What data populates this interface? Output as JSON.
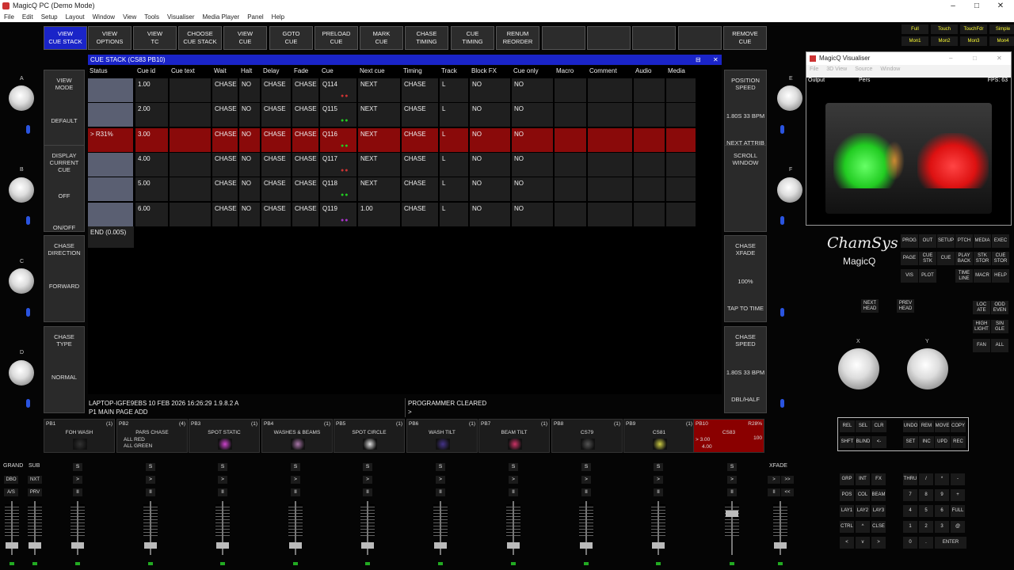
{
  "titlebar": {
    "title": "MagicQ PC (Demo Mode)",
    "minimize": "–",
    "maximize": "□",
    "close": "✕"
  },
  "menubar": [
    "File",
    "Edit",
    "Setup",
    "Layout",
    "Window",
    "View",
    "Tools",
    "Visualiser",
    "Media Player",
    "Panel",
    "Help"
  ],
  "topbar": [
    "VIEW\nCUE STACK",
    "VIEW\nOPTIONS",
    "VIEW\nTC",
    "CHOOSE\nCUE STACK",
    "VIEW\nCUE",
    "GOTO\nCUE",
    "PRELOAD\nCUE",
    "MARK\nCUE",
    "CHASE\nTIMING",
    "CUE\nTIMING",
    "RENUM\nREORDER",
    "",
    "",
    "",
    "",
    "REMOVE\nCUE"
  ],
  "left_panels": [
    {
      "a": "VIEW\nMODE",
      "b": "DEFAULT",
      "c": ""
    },
    {
      "a": "DISPLAY\nCURRENT CUE",
      "b": "OFF",
      "c": "ON/OFF"
    },
    {
      "a": "CHASE\nDIRECTION",
      "b": "FORWARD",
      "c": ""
    },
    {
      "a": "CHASE\nTYPE",
      "b": "NORMAL",
      "c": ""
    }
  ],
  "knob_labels": {
    "a": "A",
    "b": "B",
    "c": "C",
    "d": "D",
    "e": "E",
    "f": "F",
    "x": "X",
    "y": "Y"
  },
  "right_panels": [
    {
      "a": "POSITION\nSPEED",
      "b": "1.80S  33 BPM",
      "c": "NEXT ATTRIB"
    },
    {
      "a": "SCROLL\nWINDOW",
      "b": "",
      "c": ""
    },
    {
      "a": "CHASE\nXFADE",
      "b": "100%",
      "c": "TAP TO TIME"
    },
    {
      "a": "CHASE\nSPEED",
      "b": "1.80S  33 BPM",
      "c": "DBL/HALF"
    }
  ],
  "window": {
    "title": "CUE STACK (CS83 PB10)",
    "pin": "⊟",
    "close": "✕"
  },
  "columns": [
    "Status",
    "Cue id",
    "Cue text",
    "Wait",
    "Halt",
    "Delay",
    "Fade",
    "Cue",
    "Next cue",
    "Timing",
    "Track",
    "Block FX",
    "Cue only",
    "Macro",
    "Comment",
    "Audio",
    "Media"
  ],
  "rows": [
    {
      "status": "",
      "id": "1.00",
      "text": "",
      "wait": "CHASE",
      "halt": "NO",
      "delay": "CHASE",
      "fade": "CHASE",
      "cue": "Q114",
      "next": "NEXT",
      "timing": "CHASE",
      "track": "L",
      "block": "NO",
      "only": "NO",
      "dots": "#c33"
    },
    {
      "status": "",
      "id": "2.00",
      "text": "",
      "wait": "CHASE",
      "halt": "NO",
      "delay": "CHASE",
      "fade": "CHASE",
      "cue": "Q115",
      "next": "NEXT",
      "timing": "CHASE",
      "track": "L",
      "block": "NO",
      "only": "NO",
      "dots": "#2c2"
    },
    {
      "status": "> R31%",
      "id": "3.00",
      "text": "",
      "wait": "CHASE",
      "halt": "NO",
      "delay": "CHASE",
      "fade": "CHASE",
      "cue": "Q116",
      "next": "NEXT",
      "timing": "CHASE",
      "track": "L",
      "block": "NO",
      "only": "NO",
      "dots": "#2c2"
    },
    {
      "status": "",
      "id": "4.00",
      "text": "",
      "wait": "CHASE",
      "halt": "NO",
      "delay": "CHASE",
      "fade": "CHASE",
      "cue": "Q117",
      "next": "NEXT",
      "timing": "CHASE",
      "track": "L",
      "block": "NO",
      "only": "NO",
      "dots": "#c33"
    },
    {
      "status": "",
      "id": "5.00",
      "text": "",
      "wait": "CHASE",
      "halt": "NO",
      "delay": "CHASE",
      "fade": "CHASE",
      "cue": "Q118",
      "next": "NEXT",
      "timing": "CHASE",
      "track": "L",
      "block": "NO",
      "only": "NO",
      "dots": "#2c2"
    },
    {
      "status": "",
      "id": "6.00",
      "text": "",
      "wait": "CHASE",
      "halt": "NO",
      "delay": "CHASE",
      "fade": "CHASE",
      "cue": "Q119",
      "next": "1.00",
      "timing": "CHASE",
      "track": "L",
      "block": "NO",
      "only": "NO",
      "dots": "#a3c"
    }
  ],
  "end_row": "END (0.00S)",
  "statusbar": {
    "line1": "LAPTOP-IGFE9EBS 10 FEB 2026 16:26:29 1.9.8.2  A",
    "line2": "P1 MAIN PAGE   ADD",
    "prog": "PROGRAMMER CLEARED",
    "prompt": ">"
  },
  "playbacks": [
    {
      "id": "PB1",
      "count": "(1)",
      "name": "FOH WASH",
      "color": "#333"
    },
    {
      "id": "PB2",
      "count": "(4)",
      "name": "PARS CHASE",
      "sub": "ALL RED\nALL GREEN",
      "color": "#333"
    },
    {
      "id": "PB3",
      "count": "(1)",
      "name": "SPOT STATIC",
      "color": "#c4c"
    },
    {
      "id": "PB4",
      "count": "(1)",
      "name": "WASHES & BEAMS",
      "color": "#a7a"
    },
    {
      "id": "PB5",
      "count": "(1)",
      "name": "SPOT CIRCLE",
      "color": "#ddd"
    },
    {
      "id": "PB6",
      "count": "(1)",
      "name": "WASH TILT",
      "color": "#438"
    },
    {
      "id": "PB7",
      "count": "(1)",
      "name": "BEAM TILT",
      "color": "#c36"
    },
    {
      "id": "PB8",
      "count": "(1)",
      "name": "CS79",
      "color": "#555"
    },
    {
      "id": "PB9",
      "count": "(1)",
      "name": "CS81",
      "color": "#cc4"
    },
    {
      "id": "PB10",
      "count": "R28%",
      "name": "CS83",
      "cur": "> 3.00",
      "next": "4.00",
      "level": "100",
      "color": "#c00"
    }
  ],
  "grand": {
    "grand": "GRAND",
    "sub": "SUB",
    "xfade": "XFADE",
    "dbo": "DBO",
    "nxt": "NXT",
    "as": "A/S",
    "prv": "PRV",
    "s": "S",
    ">": ">",
    "ii": "II",
    ">>": ">>",
    "<<": "<<"
  },
  "visualiser": {
    "title": "MagicQ Visualiser",
    "menu": [
      "File",
      "3D View",
      "Source",
      "Window"
    ],
    "left": "Output",
    "mid": "Pers",
    "fps": "FPS: 63"
  },
  "logo": {
    "a": "ChamSys",
    "b": "MagicQ"
  },
  "keys_top": [
    [
      "PROG",
      "OUT",
      "SETUP",
      "PTCH",
      "MEDIA",
      "EXEC"
    ],
    [
      "PAGE",
      "CUE\nSTK",
      "CUE",
      "PLAY\nBACK",
      "STK\nSTOR",
      "CUE\nSTOR"
    ],
    [
      "VIS",
      "PLOT",
      "",
      "TIME\nLINE",
      "MACR",
      "HELP"
    ]
  ],
  "screen_keys": [
    [
      "Full",
      "Touch",
      "TouchFdr",
      "Simple"
    ],
    [
      "Mon1",
      "Mon2",
      "Mon3",
      "Mon4"
    ]
  ],
  "head_keys": {
    "next": "NEXT\nHEAD",
    "prev": "PREV\nHEAD"
  },
  "side_keys": [
    [
      "LOC\nATE",
      "ODD\nEVEN"
    ],
    [
      "HIGH\nLIGHT",
      "SIN\nGLE"
    ],
    [
      "FAN",
      "ALL"
    ]
  ],
  "edit_keys": [
    [
      "REL",
      "SEL",
      "CLR",
      "",
      "UNDO",
      "REM",
      "MOVE",
      "COPY"
    ],
    [
      "SHFT",
      "BLIND",
      "<-",
      "",
      "SET",
      "INC",
      "UPD",
      "REC"
    ]
  ],
  "keypad": [
    [
      "GRP",
      "INT",
      "FX",
      "",
      "THRU",
      "/",
      "*",
      "-"
    ],
    [
      "POS",
      "COL",
      "BEAM",
      "",
      "7",
      "8",
      "9",
      "+"
    ],
    [
      "LAY1",
      "LAY2",
      "LAY3",
      "",
      "4",
      "5",
      "6",
      "FULL"
    ],
    [
      "CTRL",
      "^",
      "CLSE",
      "",
      "1",
      "2",
      "3",
      "@"
    ],
    [
      "<",
      "v",
      ">",
      "",
      "0",
      ".",
      "ENTER",
      ""
    ]
  ]
}
